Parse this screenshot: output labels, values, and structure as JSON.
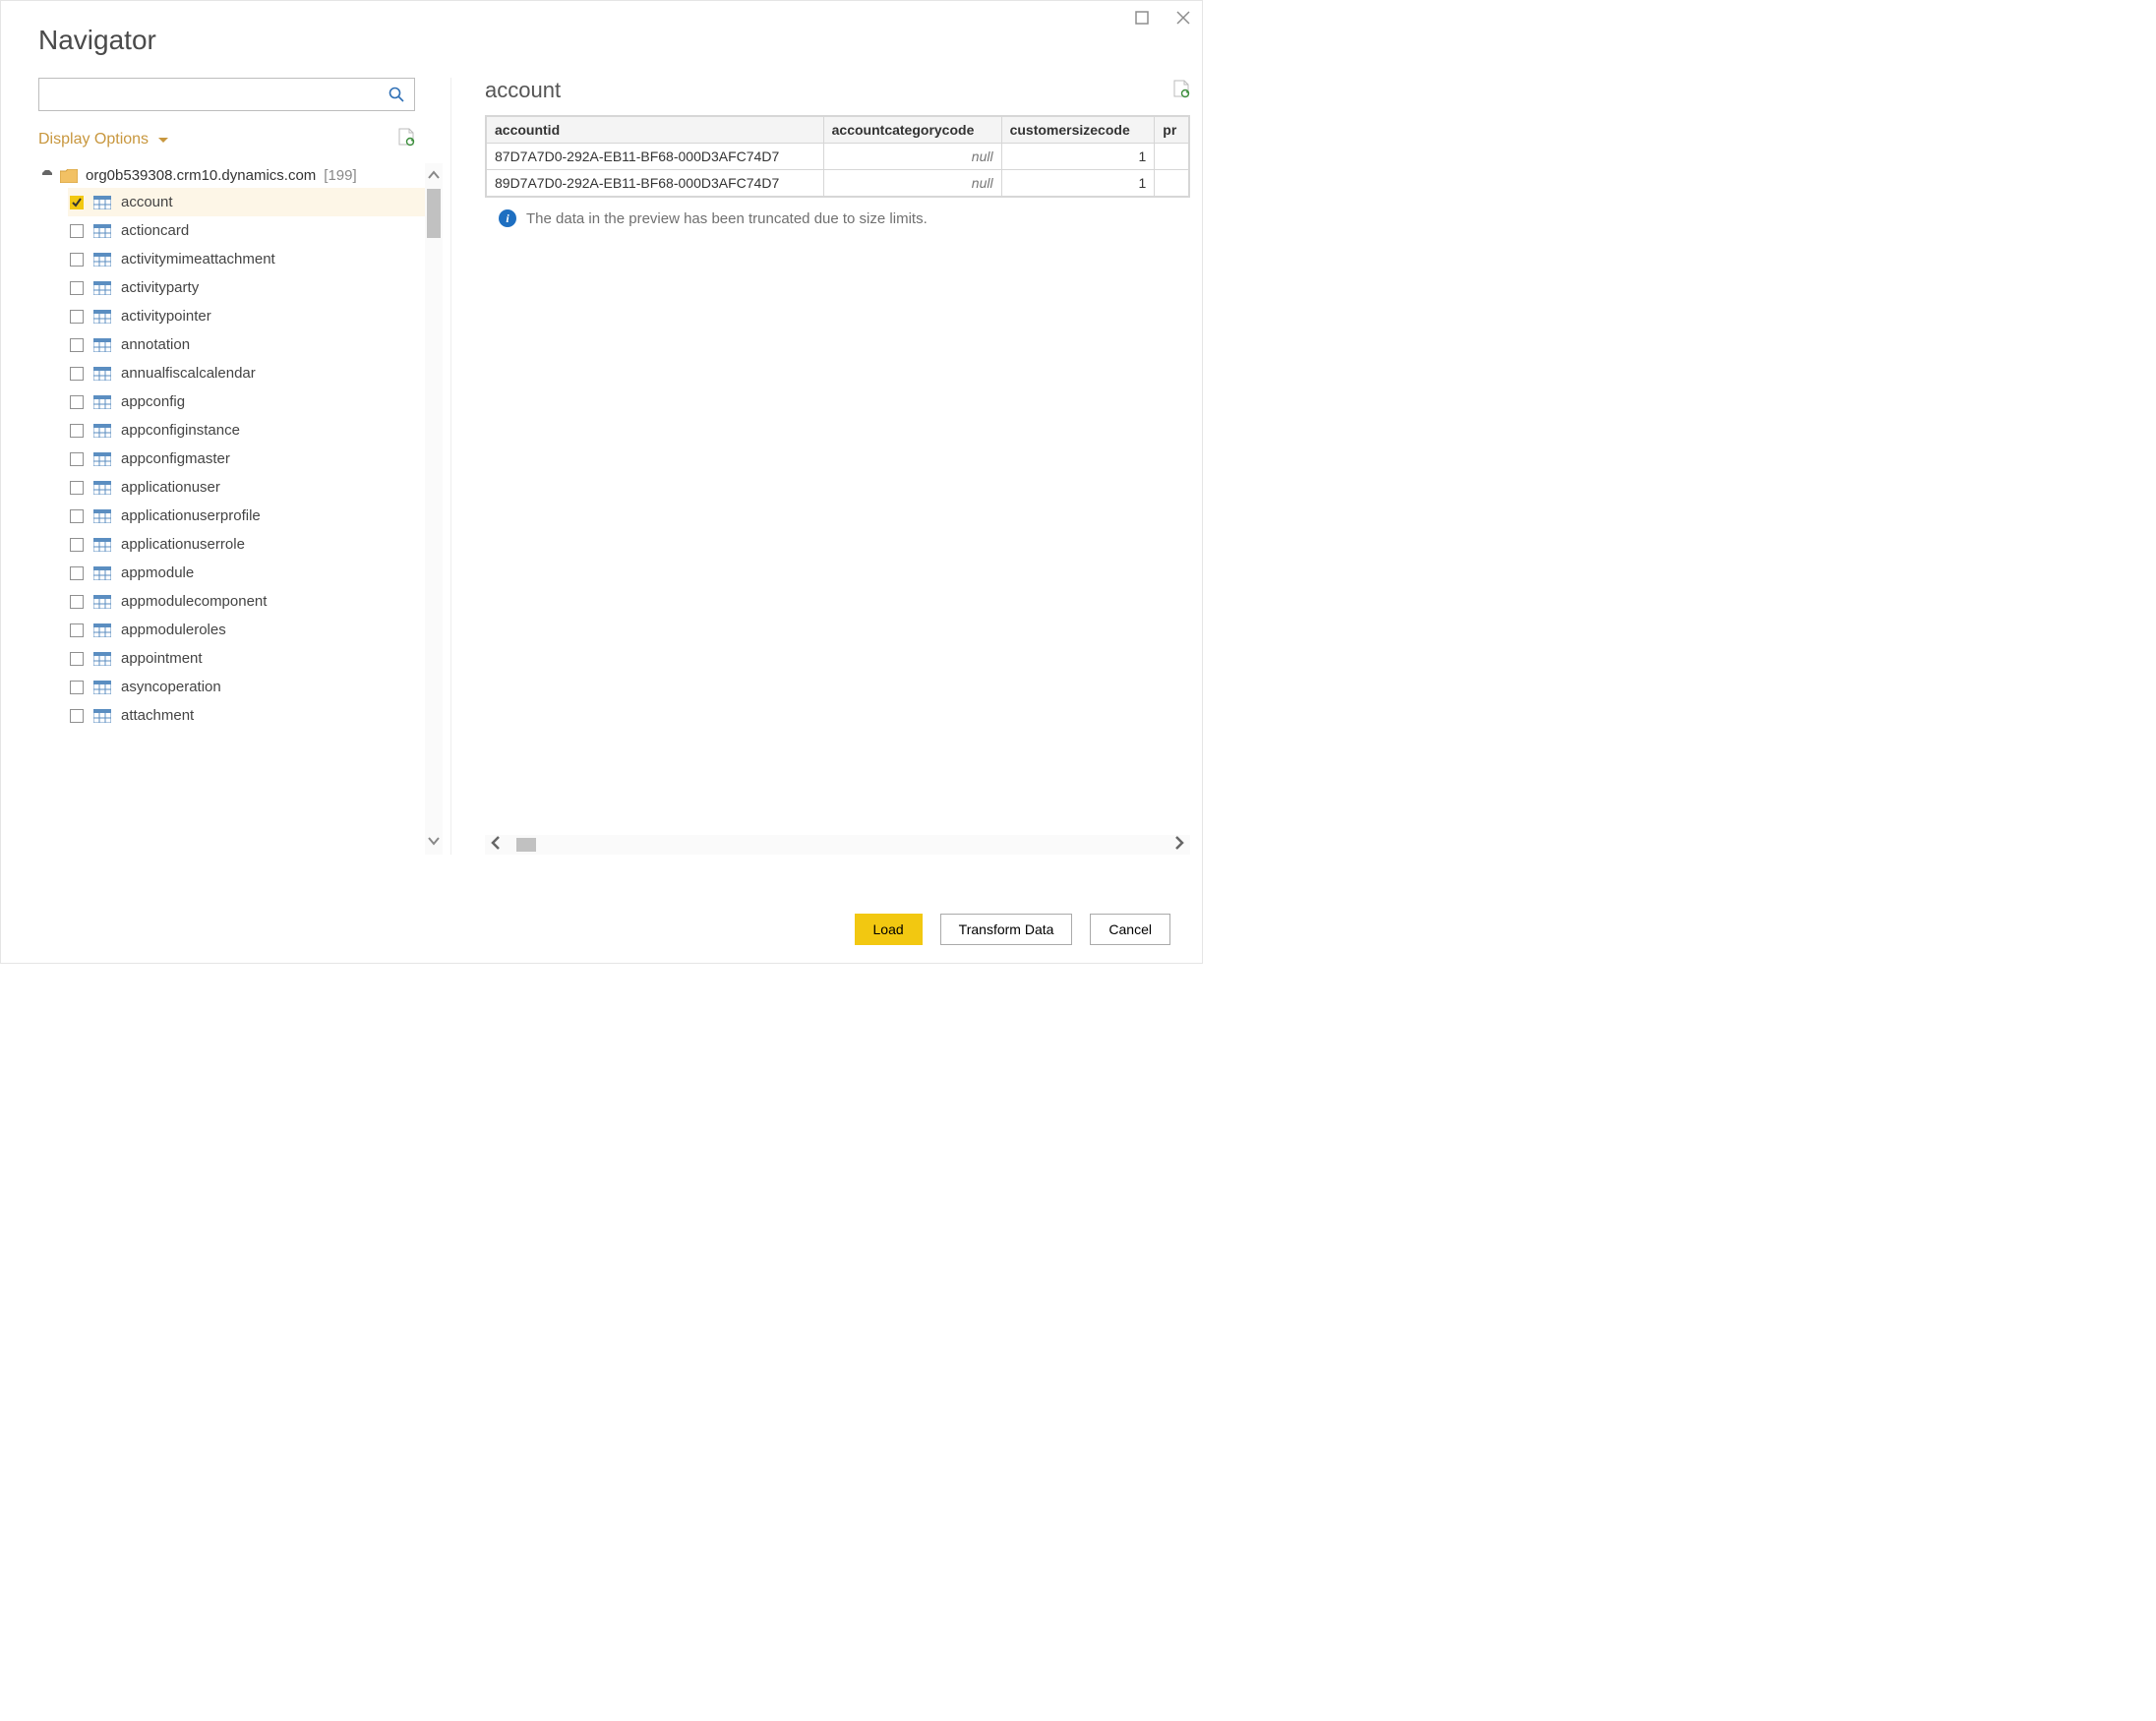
{
  "dialog": {
    "title": "Navigator"
  },
  "search": {
    "placeholder": ""
  },
  "display_options_label": "Display Options",
  "tree": {
    "root_label": "org0b539308.crm10.dynamics.com",
    "root_count": "[199]",
    "items": [
      {
        "label": "account",
        "checked": true,
        "selected": true
      },
      {
        "label": "actioncard",
        "checked": false
      },
      {
        "label": "activitymimeattachment",
        "checked": false
      },
      {
        "label": "activityparty",
        "checked": false
      },
      {
        "label": "activitypointer",
        "checked": false
      },
      {
        "label": "annotation",
        "checked": false
      },
      {
        "label": "annualfiscalcalendar",
        "checked": false
      },
      {
        "label": "appconfig",
        "checked": false
      },
      {
        "label": "appconfiginstance",
        "checked": false
      },
      {
        "label": "appconfigmaster",
        "checked": false
      },
      {
        "label": "applicationuser",
        "checked": false
      },
      {
        "label": "applicationuserprofile",
        "checked": false
      },
      {
        "label": "applicationuserrole",
        "checked": false
      },
      {
        "label": "appmodule",
        "checked": false
      },
      {
        "label": "appmodulecomponent",
        "checked": false
      },
      {
        "label": "appmoduleroles",
        "checked": false
      },
      {
        "label": "appointment",
        "checked": false
      },
      {
        "label": "asyncoperation",
        "checked": false
      },
      {
        "label": "attachment",
        "checked": false
      }
    ]
  },
  "preview": {
    "title": "account",
    "columns": [
      "accountid",
      "accountcategorycode",
      "customersizecode",
      "pr"
    ],
    "rows": [
      {
        "accountid": "87D7A7D0-292A-EB11-BF68-000D3AFC74D7",
        "accountcategorycode": "null",
        "customersizecode": "1"
      },
      {
        "accountid": "89D7A7D0-292A-EB11-BF68-000D3AFC74D7",
        "accountcategorycode": "null",
        "customersizecode": "1"
      }
    ],
    "info": "The data in the preview has been truncated due to size limits."
  },
  "footer": {
    "load": "Load",
    "transform": "Transform Data",
    "cancel": "Cancel"
  }
}
